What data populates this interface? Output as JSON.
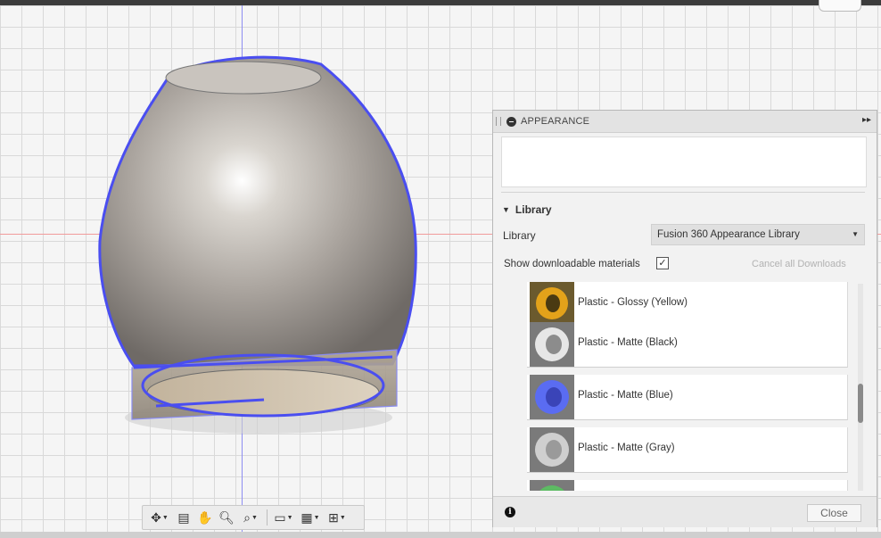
{
  "panel": {
    "title": "APPEARANCE",
    "section_title": "Library",
    "library_label": "Library",
    "library_selected": "Fusion 360 Appearance Library",
    "show_downloadable_label": "Show downloadable materials",
    "show_downloadable_checked": true,
    "checkbox_glyph": "✓",
    "cancel_downloads_label": "Cancel all Downloads",
    "close_label": "Close",
    "info_glyph": "i",
    "materials": [
      {
        "name": "Plastic - Glossy (Yellow)",
        "color": "#e3a21a"
      },
      {
        "name": "Plastic - Matte (Black)",
        "color": "#e6e6e6"
      },
      {
        "name": "Plastic - Matte (Blue)",
        "color": "#5a6cf2"
      },
      {
        "name": "Plastic - Matte (Gray)",
        "color": "#cfcfcf"
      },
      {
        "name": "",
        "color": "#5dbb63"
      }
    ]
  },
  "toolbar_icons": [
    "orbit-icon",
    "look-at-icon",
    "pan-icon",
    "zoom-icon",
    "fit-icon",
    "display-settings-icon",
    "grid-icon",
    "viewports-icon"
  ],
  "colors": {
    "selection_blue": "#4a4ef0",
    "axis_x_red": "#f19b9b",
    "axis_y_blue": "#8d8df2"
  }
}
